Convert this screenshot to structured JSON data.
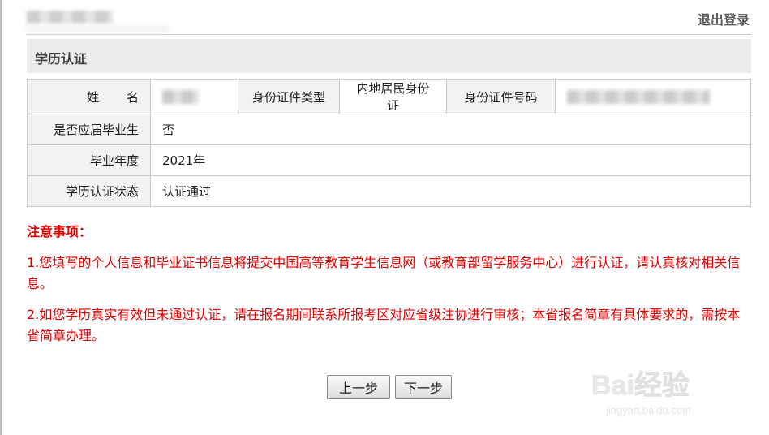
{
  "header": {
    "logout_label": "退出登录"
  },
  "section": {
    "title": "学历认证"
  },
  "table": {
    "name_label": "姓名",
    "id_type_label": "身份证件类型",
    "id_type_value": "内地居民身份证",
    "id_number_label": "身份证件号码",
    "graduate_label": "是否应届毕业生",
    "graduate_value": "否",
    "year_label": "毕业年度",
    "year_value": "2021年",
    "status_label": "学历认证状态",
    "status_value": "认证通过"
  },
  "notes": {
    "title": "注意事项：",
    "items": [
      "1.您填写的个人信息和毕业证书信息将提交中国高等教育学生信息网（或教育部留学服务中心）进行认证，请认真核对相关信息。",
      "2.如您学历真实有效但未通过认证，请在报名期间联系所报考区对应省级注协进行审核；本省报名简章有具体要求的，需按本省简章办理。"
    ]
  },
  "buttons": {
    "prev_label": "上一步",
    "next_label": "下一步"
  },
  "watermark": {
    "brand": "Bai经验",
    "url": "jingyan.baidu.com"
  }
}
